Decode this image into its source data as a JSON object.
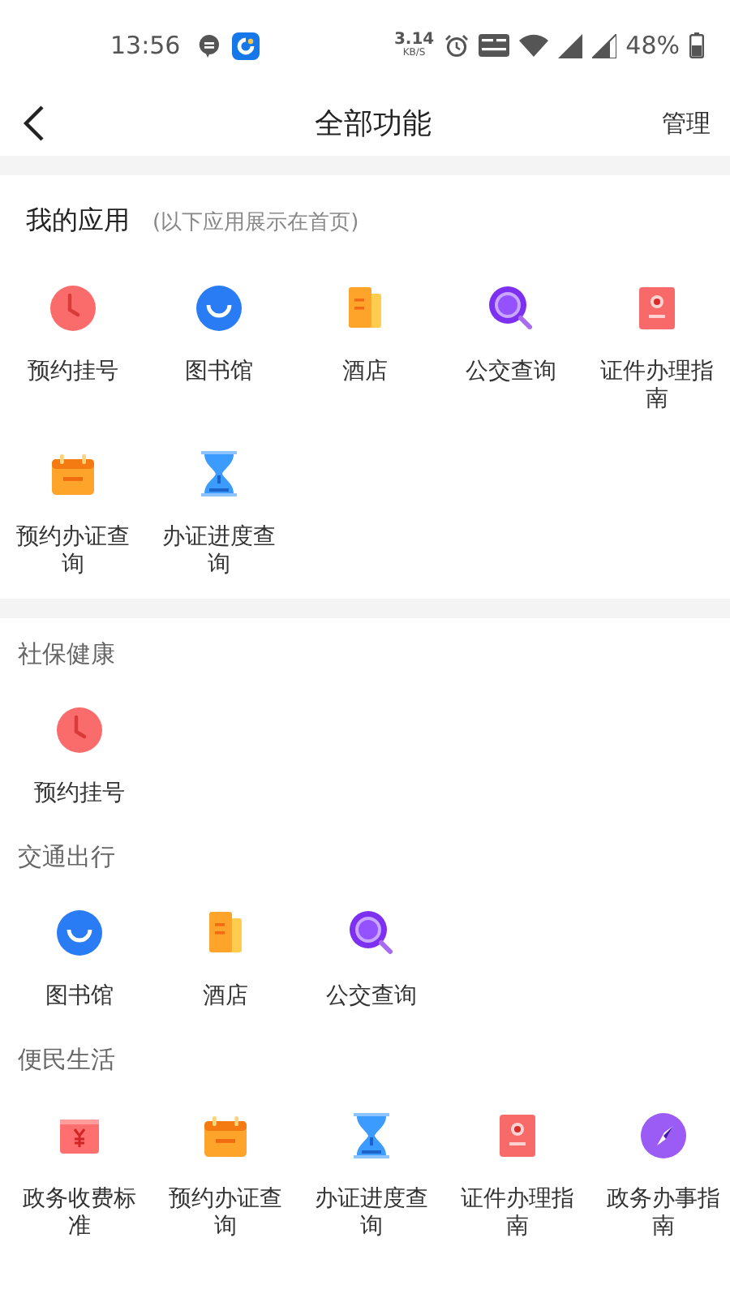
{
  "status_bar": {
    "time": "13:56",
    "speed": "3.14",
    "speed_unit": "KB/S",
    "battery": "48%"
  },
  "header": {
    "title": "全部功能",
    "action": "管理"
  },
  "my_apps": {
    "title": "我的应用",
    "hint": "(以下应用展示在首页)",
    "items": [
      {
        "label": "预约挂号",
        "kind": "clock"
      },
      {
        "label": "图书馆",
        "kind": "smile"
      },
      {
        "label": "酒店",
        "kind": "building"
      },
      {
        "label": "公交查询",
        "kind": "search"
      },
      {
        "label": "证件办理指南",
        "kind": "certificate"
      },
      {
        "label": "预约办证查询",
        "kind": "calendar"
      },
      {
        "label": "办证进度查询",
        "kind": "hourglass"
      }
    ]
  },
  "categories": [
    {
      "title": "社保健康",
      "items": [
        {
          "label": "预约挂号",
          "kind": "clock"
        }
      ]
    },
    {
      "title": "交通出行",
      "items": [
        {
          "label": "图书馆",
          "kind": "smile"
        },
        {
          "label": "酒店",
          "kind": "building"
        },
        {
          "label": "公交查询",
          "kind": "search"
        }
      ]
    },
    {
      "title": "便民生活",
      "items": [
        {
          "label": "政务收费标准",
          "kind": "money"
        },
        {
          "label": "预约办证查询",
          "kind": "calendar"
        },
        {
          "label": "办证进度查询",
          "kind": "hourglass"
        },
        {
          "label": "证件办理指南",
          "kind": "certificate"
        },
        {
          "label": "政务办事指南",
          "kind": "compass"
        }
      ]
    }
  ]
}
